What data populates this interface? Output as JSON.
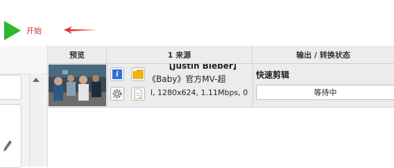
{
  "toolbar": {
    "start_label": "开始"
  },
  "table": {
    "headers": {
      "preview": "预览",
      "source": "1 来源",
      "output": "输出 / 转换状态"
    },
    "rows": [
      {
        "source_title_line1": "【Justin Bieber】",
        "source_title_line2": "《Baby》官方MV-超",
        "source_info": "l, 1280x624, 1.11Mbps, 0",
        "output_preset": "快速剪辑",
        "status": "等待中"
      }
    ]
  },
  "colors": {
    "start": "#2db82d",
    "start_label": "#c0392b",
    "arrow": "#e53935",
    "info_icon": "#2f6fd6"
  }
}
